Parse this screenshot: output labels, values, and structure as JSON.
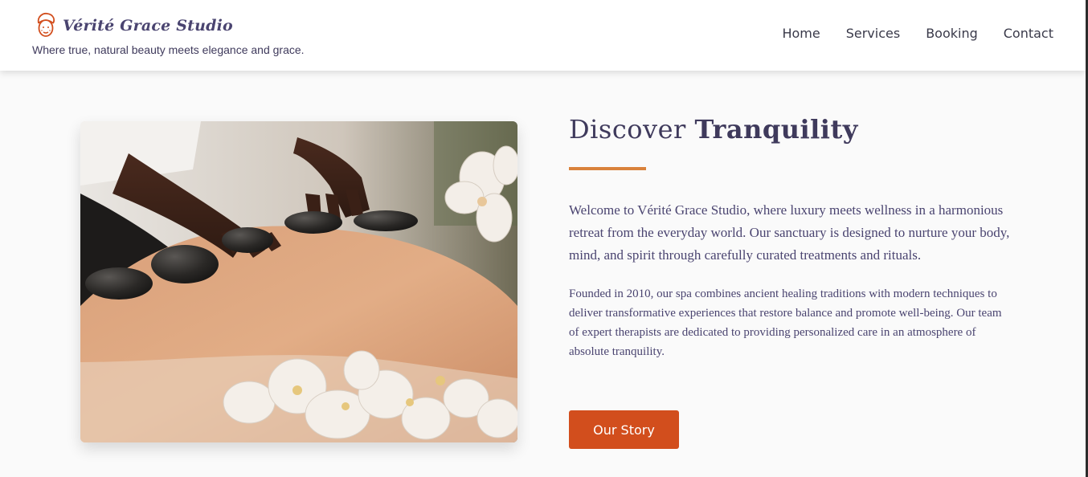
{
  "brand": {
    "name": "Vérité Grace Studio",
    "tagline": "Where true, natural beauty meets elegance and grace.",
    "logo_icon": "face-towel-icon",
    "accent_color": "#d9823b"
  },
  "nav": {
    "items": [
      "Home",
      "Services",
      "Booking",
      "Contact"
    ]
  },
  "hero": {
    "image_icon": "hot-stone-massage-photo",
    "heading_light": "Discover",
    "heading_bold": "Tranquility",
    "paragraph_1": "Welcome to Vérité Grace Studio, where luxury meets wellness in a harmonious retreat from the everyday world. Our sanctuary is designed to nurture your body, mind, and spirit through carefully curated treatments and rituals.",
    "paragraph_2": "Founded in 2010, our spa combines ancient healing traditions with modern techniques to deliver transformative experiences that restore balance and promote well-being. Our team of expert therapists are dedicated to providing personalized care in an atmosphere of absolute tranquility.",
    "button_label": "Our Story",
    "button_color": "#d24e1d"
  }
}
